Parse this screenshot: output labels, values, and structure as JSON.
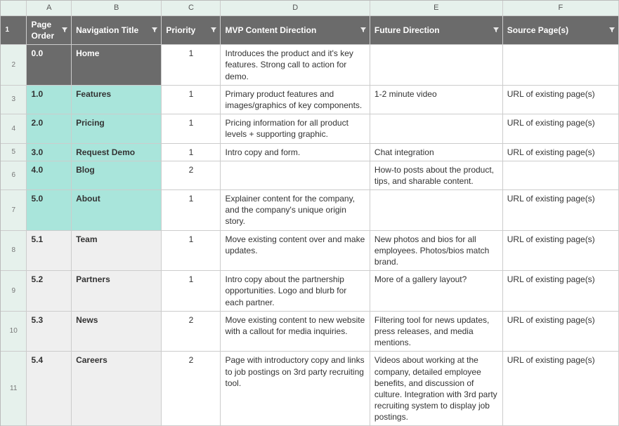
{
  "columns": [
    "A",
    "B",
    "C",
    "D",
    "E",
    "F"
  ],
  "headers": {
    "A": "Page Order",
    "B": "Navigation Title",
    "C": "Priority",
    "D": "MVP Content Direction",
    "E": "Future Direction",
    "F": "Source Page(s)"
  },
  "row_numbers": [
    "1",
    "2",
    "3",
    "4",
    "5",
    "6",
    "7",
    "8",
    "9",
    "10",
    "11"
  ],
  "rows": [
    {
      "A": "0.0",
      "B": "Home",
      "C": "1",
      "D": "Introduces the product and it's key features. Strong call to action for demo.",
      "E": "",
      "F": "",
      "bgA": "dark",
      "bgB": "dark"
    },
    {
      "A": "1.0",
      "B": "Features",
      "C": "1",
      "D": "Primary product features and images/graphics of key components.",
      "E": "1-2 minute video",
      "F": "URL of existing page(s)",
      "bgA": "teal",
      "bgB": "teal"
    },
    {
      "A": "2.0",
      "B": "Pricing",
      "C": "1",
      "D": "Pricing information for all product levels + supporting graphic.",
      "E": "",
      "F": "URL of existing page(s)",
      "bgA": "teal",
      "bgB": "teal"
    },
    {
      "A": "3.0",
      "B": "Request Demo",
      "C": "1",
      "D": "Intro copy and form.",
      "E": "Chat integration",
      "F": "URL of existing page(s)",
      "bgA": "teal",
      "bgB": "teal"
    },
    {
      "A": "4.0",
      "B": "Blog",
      "C": "2",
      "D": "",
      "E": "How-to posts about the product, tips, and sharable content.",
      "F": "",
      "bgA": "teal",
      "bgB": "teal"
    },
    {
      "A": "5.0",
      "B": "About",
      "C": "1",
      "D": "Explainer content for the company, and the company's unique origin story.",
      "E": "",
      "F": "URL of existing page(s)",
      "bgA": "teal",
      "bgB": "teal"
    },
    {
      "A": "5.1",
      "B": "Team",
      "C": "1",
      "D": "Move existing content over and make updates.",
      "E": "New photos and bios for all employees. Photos/bios match brand.",
      "F": "URL of existing page(s)",
      "bgA": "gray",
      "bgB": "gray"
    },
    {
      "A": "5.2",
      "B": "Partners",
      "C": "1",
      "D": "Intro copy about the partnership opportunities. Logo and blurb for each partner.",
      "E": "More of a gallery layout?",
      "F": "URL of existing page(s)",
      "bgA": "gray",
      "bgB": "gray"
    },
    {
      "A": "5.3",
      "B": "News",
      "C": "2",
      "D": "Move existing content to new website with a callout for media inquiries.",
      "E": "Filtering tool for news updates, press releases, and media mentions.",
      "F": "URL of existing page(s)",
      "bgA": "gray",
      "bgB": "gray"
    },
    {
      "A": "5.4",
      "B": "Careers",
      "C": "2",
      "D": "Page with introductory copy and links to job postings on 3rd party recruiting tool.",
      "E": "Videos about working at the company, detailed employee benefits, and discussion of culture. Integration with 3rd party recruiting system to display job postings.",
      "F": "URL of existing page(s)",
      "bgA": "gray",
      "bgB": "gray"
    }
  ]
}
